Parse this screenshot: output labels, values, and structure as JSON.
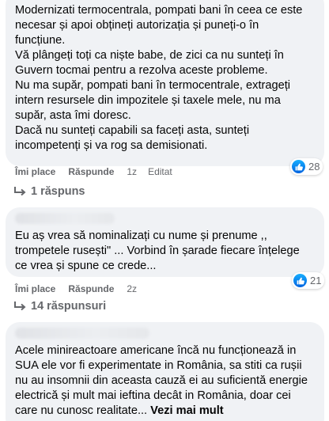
{
  "comments": [
    {
      "text": "Modernizati termocentrala, pompati bani în ceea ce este\nnecesar și apoi obțineți autorizația și puneți-o în\nfuncțiune.\nVă plângeți toți ca niște babe, de zici ca nu sunteți în\nGuvern tocmai pentru a rezolva aceste probleme.\nNu ma supăr, pompati bani în termocentrale, extrageți\nintern resursele din impozitele și taxele mele, nu ma\nsupăr, asta îmi doresc.\nDacă nu sunteți capabili sa faceți asta, sunteți\nincompetenți și va rog sa demisionati.",
      "like_label": "Îmi place",
      "reply_label": "Răspunde",
      "time": "1z",
      "edited": "Editat",
      "reaction_count": "28",
      "replies_label": "1 răspuns"
    },
    {
      "text": "Eu aș vrea să nominalizați cu nume și prenume ,, \ntrompetele rusești\" ... Vorbind în șarade fiecare înțelege\nce vrea și spune ce crede...",
      "like_label": "Îmi place",
      "reply_label": "Răspunde",
      "time": "2z",
      "reaction_count": "21",
      "replies_label": "14 răspunsuri"
    },
    {
      "text": "Acele minireactoare americane încă nu funcționează in\nSUA ele vor fi experimentate in România, sa stiti ca rușii\nnu au insomnii din aceasta cauză ei au suficientă energie\nelectrică și mult mai ieftina decât in România, doar cei\ncare nu cunosc realitate... ",
      "see_more": "Vezi mai mult"
    }
  ],
  "colors": {
    "bubble_bg": "#f0f2f5",
    "meta_text": "#65676b",
    "like_blue": "#0866ff"
  },
  "icons": [
    "like-icon",
    "reply-arrow-icon"
  ]
}
